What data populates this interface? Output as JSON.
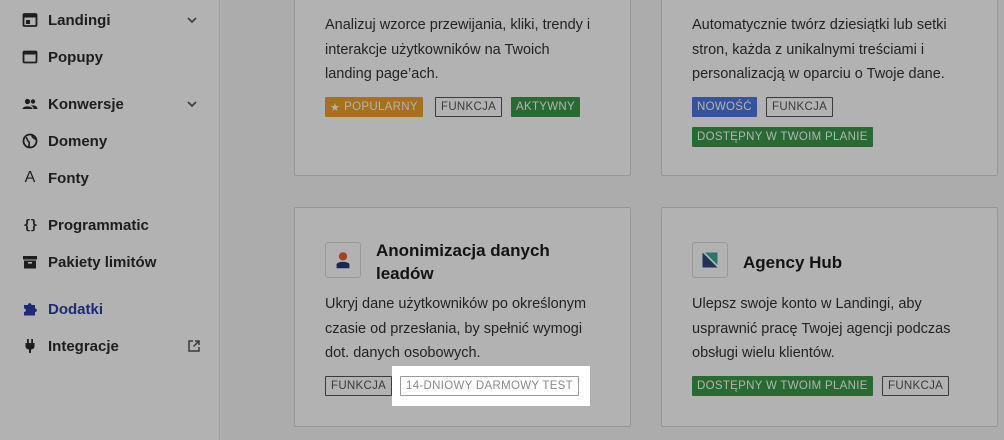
{
  "sidebar": {
    "items": [
      {
        "label": "Landingi",
        "icon": "landing-icon",
        "chevron": true
      },
      {
        "label": "Popupy",
        "icon": "popup-icon"
      },
      {
        "label": "Konwersje",
        "icon": "users-icon",
        "chevron": true
      },
      {
        "label": "Domeny",
        "icon": "globe-icon"
      },
      {
        "label": "Fonty",
        "icon": "font-icon"
      },
      {
        "label": "Programmatic",
        "icon": "braces-icon"
      },
      {
        "label": "Pakiety limitów",
        "icon": "package-icon"
      },
      {
        "label": "Dodatki",
        "icon": "puzzle-icon",
        "active": true
      },
      {
        "label": "Integracje",
        "icon": "plug-icon",
        "external": true
      }
    ]
  },
  "cards": {
    "top_left": {
      "desc_lines": [
        "Analizuj wzorce przewijania, kliki, trendy i",
        "interakcje użytkowników na Twoich",
        "landing page’ach."
      ],
      "tags": [
        "POPULARNY",
        "FUNKCJA",
        "AKTYWNY"
      ]
    },
    "top_right": {
      "desc_lines": [
        "Automatycznie twórz dziesiątki lub setki",
        "stron, każda z unikalnymi treściami i",
        "personalizacją w oparciu o Twoje dane."
      ],
      "tags": [
        "NOWOŚĆ",
        "FUNKCJA",
        "DOSTĘPNY W TWOIM PLANIE"
      ]
    },
    "bottom_left": {
      "title_lines": [
        "Anonimizacja danych",
        "leadów"
      ],
      "desc_lines": [
        "Ukryj dane użytkowników po określonym",
        "czasie od przesłania, by spełnić wymogi",
        "dot. danych osobowych."
      ],
      "tags": [
        "FUNKCJA",
        "14-DNIOWY DARMOWY TEST"
      ]
    },
    "bottom_right": {
      "title": "Agency Hub",
      "desc_lines": [
        "Ulepsz swoje konto w Landingi, aby",
        "usprawnić pracę Twojej agencji podczas",
        "obsługi wielu klientów."
      ],
      "tags": [
        "DOSTĘPNY W TWOIM PLANIE",
        "FUNKCJA"
      ]
    }
  },
  "colors": {
    "accent": "#2a3ea6",
    "tag_orange": "#f0a12c",
    "tag_green": "#3a9a48",
    "tag_blue": "#4c78dd"
  }
}
